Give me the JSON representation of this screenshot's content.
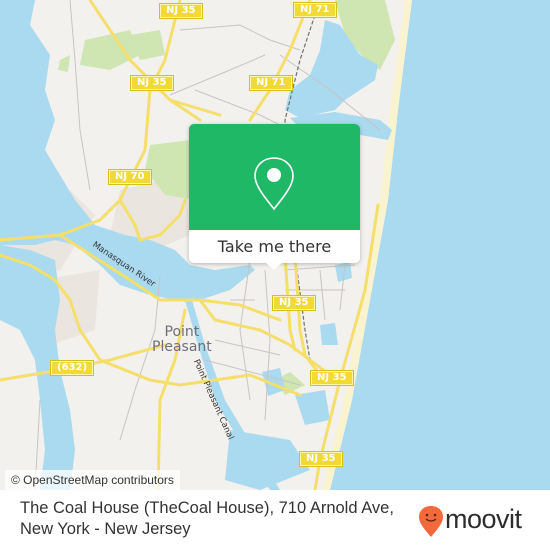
{
  "map": {
    "colors": {
      "land": "#f2f1ee",
      "water": "#aadaef",
      "park": "#cfe6b3",
      "residential": "#ebe5e0",
      "beach": "#f9f3d0",
      "major_road": "#f5df6a",
      "minor_road": "#c8c4c0",
      "railway": "#707070"
    },
    "road_shields": [
      {
        "label": "NJ 35",
        "id": "nj35-top"
      },
      {
        "label": "NJ 71",
        "id": "nj71-top"
      },
      {
        "label": "NJ 35",
        "id": "nj35-upper"
      },
      {
        "label": "NJ 71",
        "id": "nj71-mid"
      },
      {
        "label": "NJ 70",
        "id": "nj70"
      },
      {
        "label": "NJ 35",
        "id": "nj35-center"
      },
      {
        "label": "(632)",
        "id": "cr632"
      },
      {
        "label": "NJ 35",
        "id": "nj35-lower"
      },
      {
        "label": "NJ 35",
        "id": "nj35-bottom"
      }
    ],
    "places": [
      {
        "label": "Point\nPleasant",
        "line1": "Point",
        "line2": "Pleasant"
      }
    ],
    "water_labels": [
      {
        "label": "Manasquan River"
      },
      {
        "label": "Point Pleasant Canal"
      }
    ],
    "attribution": "© OpenStreetMap contributors"
  },
  "popup": {
    "icon": "location-pin-icon",
    "button_label": "Take me there",
    "color": "#1fb866"
  },
  "footer": {
    "title": "The Coal House (TheCoal House), 710 Arnold Ave, New York - New Jersey",
    "logo": {
      "text": "moovit",
      "icon": "moovit-smiley-pin-icon",
      "color": "#f26a3c"
    }
  }
}
